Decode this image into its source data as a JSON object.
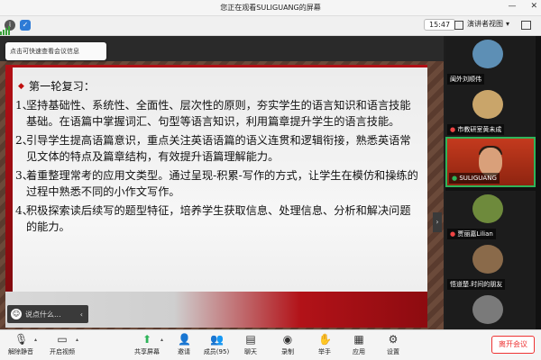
{
  "window": {
    "title": "您正在观看SULIGUANG的屏幕",
    "min": "—",
    "close": "✕"
  },
  "topbar": {
    "time": "15:47",
    "view_label": "演讲者视图"
  },
  "tooltip": "点击可快速查看会议信息",
  "slide": {
    "heading": "第一轮复习：",
    "items": [
      {
        "num": "1、",
        "text": "坚持基础性、系统性、全面性、层次性的原则，夯实学生的语言知识和语言技能基础。在语篇中掌握词汇、句型等语言知识，利用篇章提升学生的语言技能。"
      },
      {
        "num": "2、",
        "text": "引导学生提高语篇意识，重点关注英语语篇的语义连贯和逻辑衔接，熟悉英语常见文体的特点及篇章结构，有效提升语篇理解能力。"
      },
      {
        "num": "3、",
        "text": "着重整理常考的应用文类型。通过呈现-积累-写作的方式，让学生在模仿和操练的过程中熟悉不同的小作文写作。"
      },
      {
        "num": "4、",
        "text": "积极探索读后续写的题型特征，培养学生获取信息、处理信息、分析和解决问题的能力。"
      }
    ],
    "chat_placeholder": "说点什么...",
    "chat_chevron": "‹"
  },
  "participants": [
    {
      "name": "闽外刘顺伟",
      "color": "#5d8fb5"
    },
    {
      "name": "市教研室黄未成",
      "color": "#c9a56a"
    },
    {
      "name": "SULIGUANG",
      "color": "#c43a1e"
    },
    {
      "name": "贾丽嘉Lilian",
      "color": "#6e8a3c"
    },
    {
      "name": "悟道楚.时间的朋友",
      "color": "#8a6a4a"
    },
    {
      "name": "",
      "color": "#7a7a7a"
    }
  ],
  "toolbar": {
    "mute": "解除静音",
    "video": "开启视频",
    "share": "共享屏幕",
    "invite": "邀请",
    "members": "成员(95)",
    "chat": "聊天",
    "record": "录制",
    "raise": "举手",
    "apps": "应用",
    "settings": "设置",
    "leave": "离开会议"
  },
  "colors": {
    "accent_red": "#b10f15",
    "leave_red": "#e33333",
    "active_green": "#2fb45a"
  }
}
